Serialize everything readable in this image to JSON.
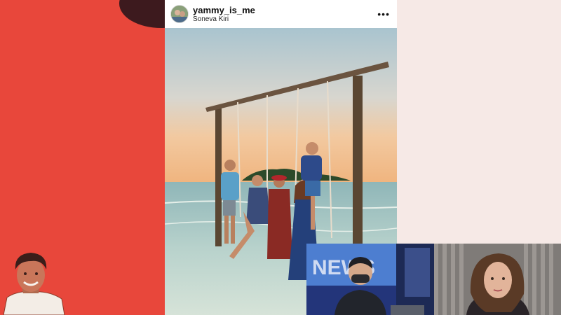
{
  "post": {
    "username": "yammy_is_me",
    "location": "Soneva Kiri",
    "more_icon": "more-horizontal-icon"
  },
  "news_tile": {
    "banner_text": "NEWS"
  },
  "colors": {
    "left_panel": "#e8473b",
    "right_panel": "#f6e9e6",
    "post_bg": "#ffffff"
  }
}
